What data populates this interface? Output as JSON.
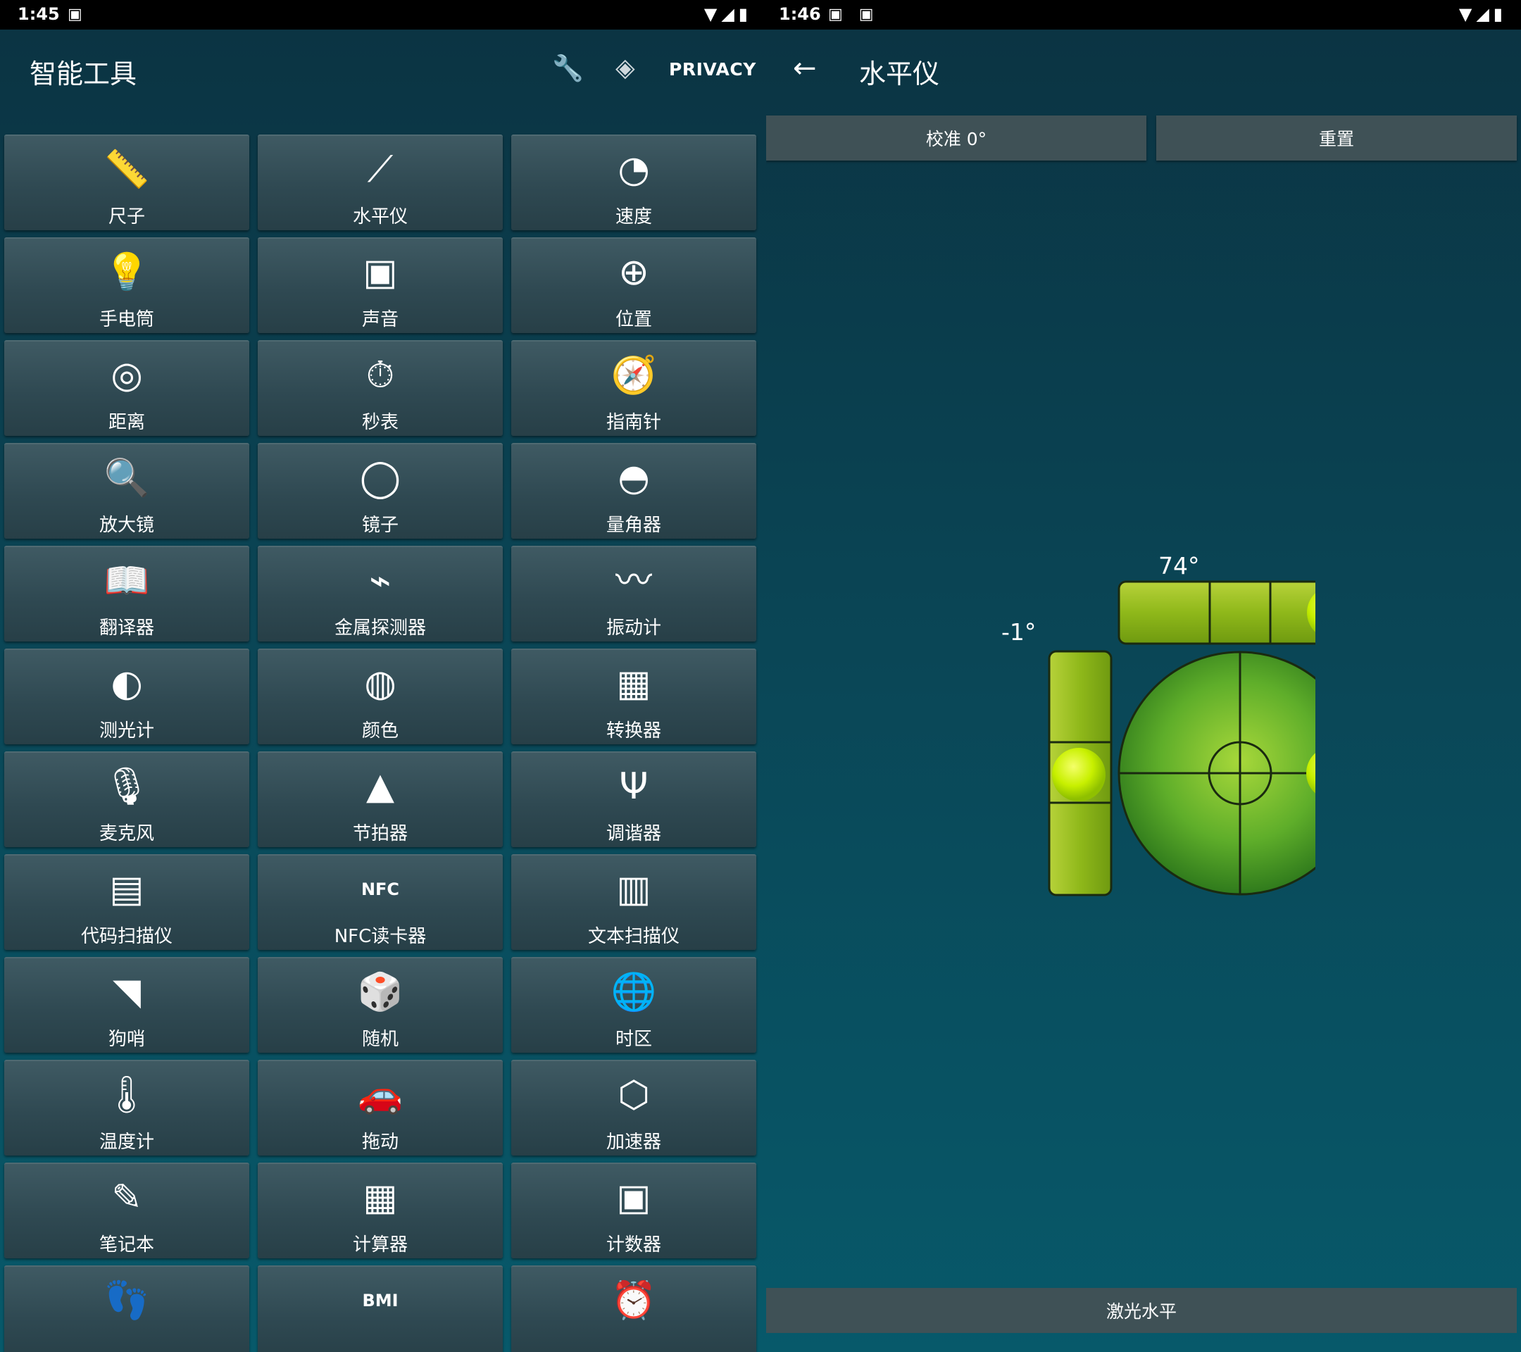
{
  "left_screen": {
    "status": {
      "time": "1:45",
      "left_icons": "▣",
      "right_icons": "▼◢▮"
    },
    "header": {
      "title": "智能工具",
      "wrench_icon": "🔧",
      "nav_icon": "◈",
      "privacy_label": "PRIVACY"
    },
    "tools": [
      {
        "label": "尺子",
        "icon": "📏"
      },
      {
        "label": "水平仪",
        "icon": "⟋"
      },
      {
        "label": "速度",
        "icon": "◔"
      },
      {
        "label": "手电筒",
        "icon": "💡"
      },
      {
        "label": "声音",
        "icon": "▣"
      },
      {
        "label": "位置",
        "icon": "⊕"
      },
      {
        "label": "距离",
        "icon": "◎"
      },
      {
        "label": "秒表",
        "icon": "⏱"
      },
      {
        "label": "指南针",
        "icon": "🧭"
      },
      {
        "label": "放大镜",
        "icon": "🔍"
      },
      {
        "label": "镜子",
        "icon": "◯"
      },
      {
        "label": "量角器",
        "icon": "◓"
      },
      {
        "label": "翻译器",
        "icon": "📖"
      },
      {
        "label": "金属探测器",
        "icon": "⌁"
      },
      {
        "label": "振动计",
        "icon": "〰"
      },
      {
        "label": "测光计",
        "icon": "◐"
      },
      {
        "label": "颜色",
        "icon": "◍"
      },
      {
        "label": "转换器",
        "icon": "▦"
      },
      {
        "label": "麦克风",
        "icon": "🎙"
      },
      {
        "label": "节拍器",
        "icon": "▲"
      },
      {
        "label": "调谐器",
        "icon": "Ψ"
      },
      {
        "label": "代码扫描仪",
        "icon": "▤"
      },
      {
        "label": "NFC读卡器",
        "icon": "NFC"
      },
      {
        "label": "文本扫描仪",
        "icon": "▥"
      },
      {
        "label": "狗哨",
        "icon": "◥"
      },
      {
        "label": "随机",
        "icon": "🎲"
      },
      {
        "label": "时区",
        "icon": "🌐"
      },
      {
        "label": "温度计",
        "icon": "🌡"
      },
      {
        "label": "拖动",
        "icon": "🚗"
      },
      {
        "label": "加速器",
        "icon": "⬡"
      },
      {
        "label": "笔记本",
        "icon": "✎"
      },
      {
        "label": "计算器",
        "icon": "▦"
      },
      {
        "label": "计数器",
        "icon": "▣"
      },
      {
        "label": "",
        "icon": "👣"
      },
      {
        "label": "",
        "icon": "BMI"
      },
      {
        "label": "",
        "icon": "⏰"
      }
    ]
  },
  "right_screen": {
    "status": {
      "time": "1:46",
      "left_icons": "▣ ▣",
      "right_icons": "▼◢▮"
    },
    "header": {
      "back_icon": "←",
      "title": "水平仪"
    },
    "calibrate_label": "校准 0°",
    "reset_label": "重置",
    "laser_label": "激光水平",
    "horizontal_angle": "74°",
    "vertical_angle": "-1°",
    "bubble_color": "#c8f000",
    "tube_color": "#9bc21c",
    "circle_color": "#5fae2a"
  }
}
